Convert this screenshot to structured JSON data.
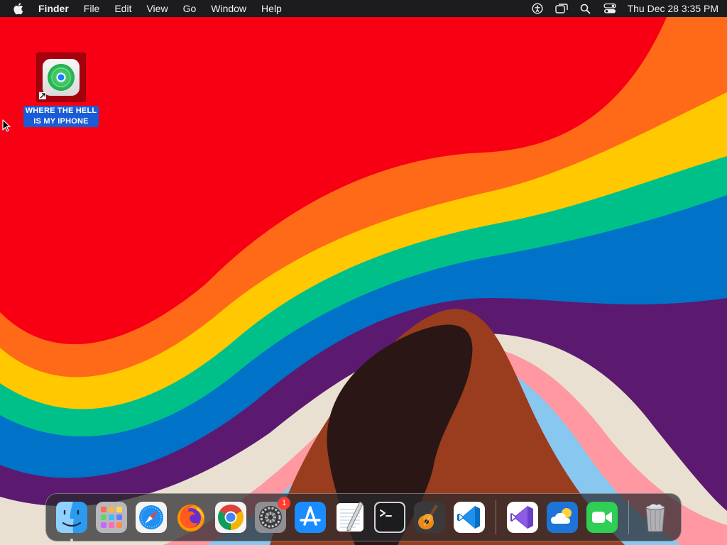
{
  "menubar": {
    "apple": "apple-logo",
    "app_name": "Finder",
    "items": [
      "File",
      "Edit",
      "View",
      "Go",
      "Window",
      "Help"
    ],
    "status_icons": [
      "accessibility-icon",
      "window-switch-icon",
      "spotlight-search-icon",
      "control-center-icon"
    ],
    "clock": "Thu Dec 28  3:35 PM"
  },
  "desktop": {
    "icon": {
      "label_line1": "WHERE THE HELL",
      "label_line2": "IS MY IPHONE",
      "glyph": "find-my-icon",
      "alias": true,
      "selected": true
    }
  },
  "dock": {
    "items": [
      {
        "name": "Finder",
        "icon": "finder-icon",
        "running": true
      },
      {
        "name": "Launchpad",
        "icon": "launchpad-icon"
      },
      {
        "name": "Safari",
        "icon": "safari-icon"
      },
      {
        "name": "Firefox",
        "icon": "firefox-icon"
      },
      {
        "name": "Google Chrome",
        "icon": "chrome-icon"
      },
      {
        "name": "System Settings",
        "icon": "system-settings-icon",
        "badge": "1"
      },
      {
        "name": "App Store",
        "icon": "app-store-icon"
      },
      {
        "name": "TextEdit",
        "icon": "textedit-icon"
      },
      {
        "name": "Terminal",
        "icon": "terminal-icon"
      },
      {
        "name": "GarageBand",
        "icon": "garageband-icon"
      },
      {
        "name": "Visual Studio Code",
        "icon": "vscode-icon"
      }
    ],
    "recent": [
      {
        "name": "Visual Studio",
        "icon": "visual-studio-icon"
      },
      {
        "name": "Weather",
        "icon": "weather-icon"
      },
      {
        "name": "FaceTime",
        "icon": "facetime-icon"
      }
    ],
    "trash": {
      "name": "Trash",
      "icon": "trash-icon"
    }
  },
  "colors": {
    "red": "#f70014",
    "orange": "#ff6a19",
    "yellow": "#ffc800",
    "green": "#00c08a",
    "blue": "#0072c8",
    "purple": "#5c1970",
    "cream": "#e9e0d1",
    "pink": "#ff98a0",
    "light_blue": "#88c8f0",
    "brown": "#9a3d1e",
    "dark_brown": "#2a1715",
    "selection": "#1a5cd6"
  }
}
